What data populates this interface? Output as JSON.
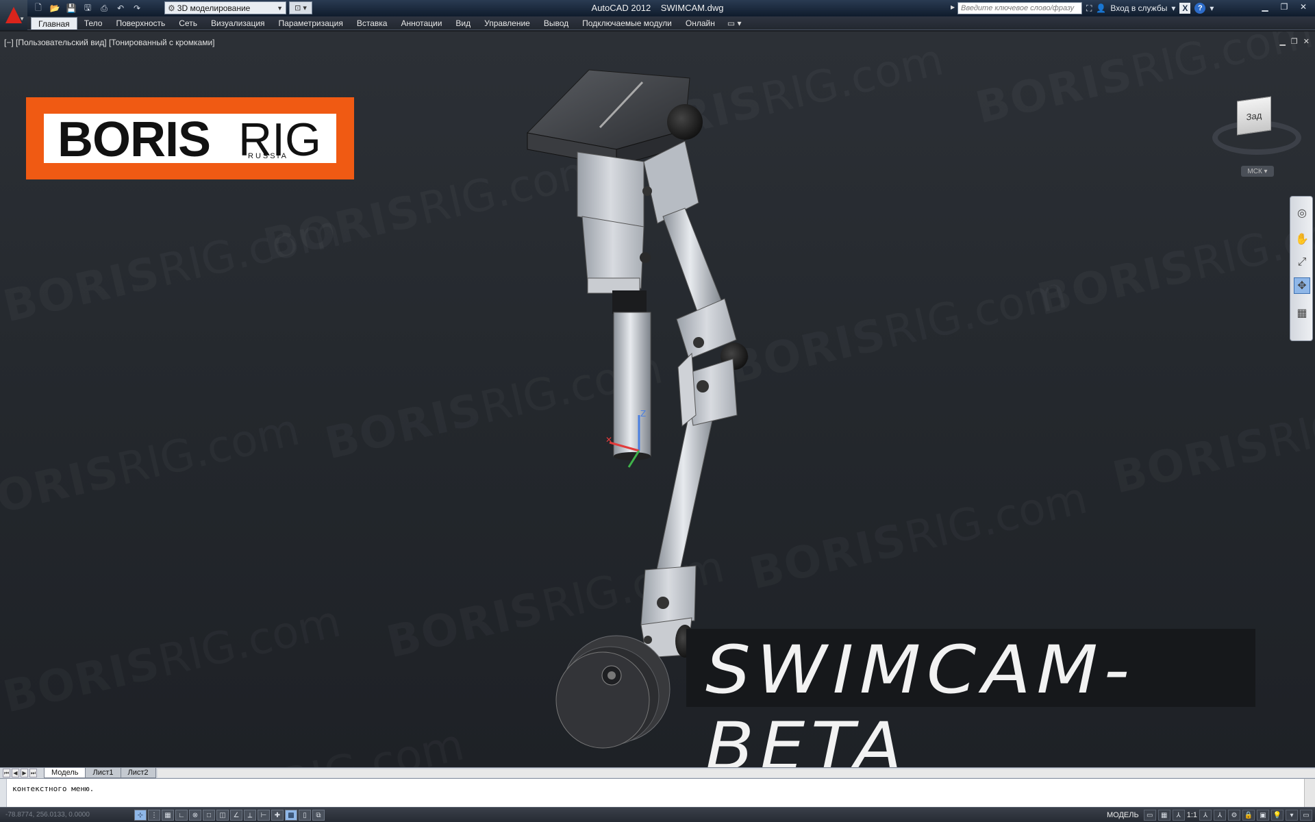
{
  "titlebar": {
    "app_name": "AutoCAD 2012",
    "file_name": "SWIMCAM.dwg",
    "workspace": "3D моделирование",
    "search_placeholder": "Введите ключевое слово/фразу",
    "login": "Вход в службы",
    "x_badge": "X",
    "help": "?"
  },
  "menu": {
    "tabs": [
      "Главная",
      "Тело",
      "Поверхность",
      "Сеть",
      "Визуализация",
      "Параметризация",
      "Вставка",
      "Аннотации",
      "Вид",
      "Управление",
      "Вывод",
      "Подключаемые модули",
      "Онлайн"
    ],
    "active_index": 0
  },
  "viewport": {
    "label": "[−] [Пользовательский вид] [Тонированный с кромками]",
    "viewcube_face": "Зад",
    "wcs_label": "МСК"
  },
  "brand": {
    "bold": "BORIS",
    "rig": "RIG",
    "sub": "RUSSIA"
  },
  "watermark": {
    "bold": "BORIS",
    "rest": "RIG.com"
  },
  "overlay_title": "SWIMCAM-BETA",
  "layout_tabs": [
    "Модель",
    "Лист1",
    "Лист2"
  ],
  "command_line": {
    "text": "контекстного меню."
  },
  "status": {
    "coords": "-78.8774, 256.0133, 0.0000",
    "model_label": "МОДЕЛЬ",
    "scale": "1:1"
  },
  "colors": {
    "brand_orange": "#f05a13",
    "viewport_bg": "#24282d",
    "axis_x": "#e23b3b",
    "axis_y": "#3fb34a",
    "axis_z": "#4a7fe0"
  }
}
